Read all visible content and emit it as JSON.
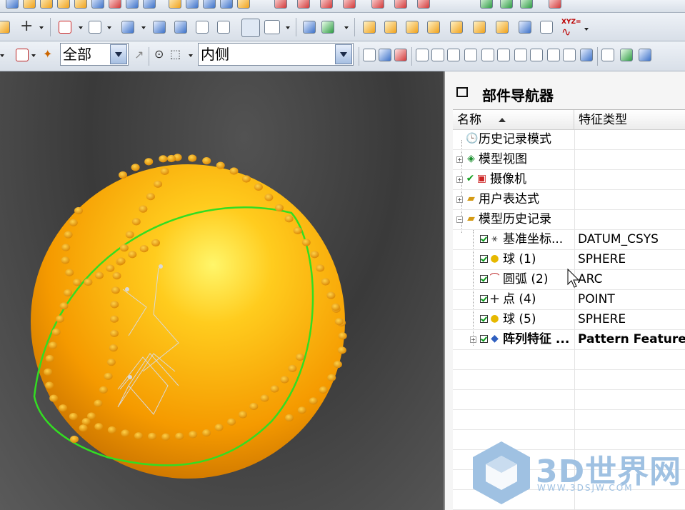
{
  "toolbar": {
    "filter_combo_value": "全部",
    "side_combo_value": "内侧",
    "xyz_label": "XYZ="
  },
  "navigator": {
    "title": "部件导航器",
    "columns": {
      "name": "名称",
      "type": "特征类型"
    },
    "rows": [
      {
        "name": "历史记录模式",
        "type": "",
        "icon": "clock-icon"
      },
      {
        "name": "模型视图",
        "type": "",
        "icon": "model-view-icon"
      },
      {
        "name": "摄像机",
        "type": "",
        "icon": "camera-icon"
      },
      {
        "name": "用户表达式",
        "type": "",
        "icon": "folder-icon"
      },
      {
        "name": "模型历史记录",
        "type": "",
        "icon": "folder-icon"
      },
      {
        "name": "基准坐标...",
        "type": "DATUM_CSYS",
        "icon": "datum-csys-icon"
      },
      {
        "name": "球 (1)",
        "type": "SPHERE",
        "icon": "sphere-icon"
      },
      {
        "name": "圆弧 (2)",
        "type": "ARC",
        "icon": "arc-icon"
      },
      {
        "name": "点 (4)",
        "type": "POINT",
        "icon": "point-icon"
      },
      {
        "name": "球 (5)",
        "type": "SPHERE",
        "icon": "sphere-icon"
      },
      {
        "name": "阵列特征 ...",
        "type": "Pattern Feature",
        "icon": "pattern-feature-icon"
      }
    ]
  },
  "watermark": {
    "text": "3D世界网",
    "url": "WWW.3DSJW.COM"
  },
  "colors": {
    "sphere": "#f7a400",
    "arc": "#33dd22",
    "bg_dark": "#3a3a3a"
  }
}
